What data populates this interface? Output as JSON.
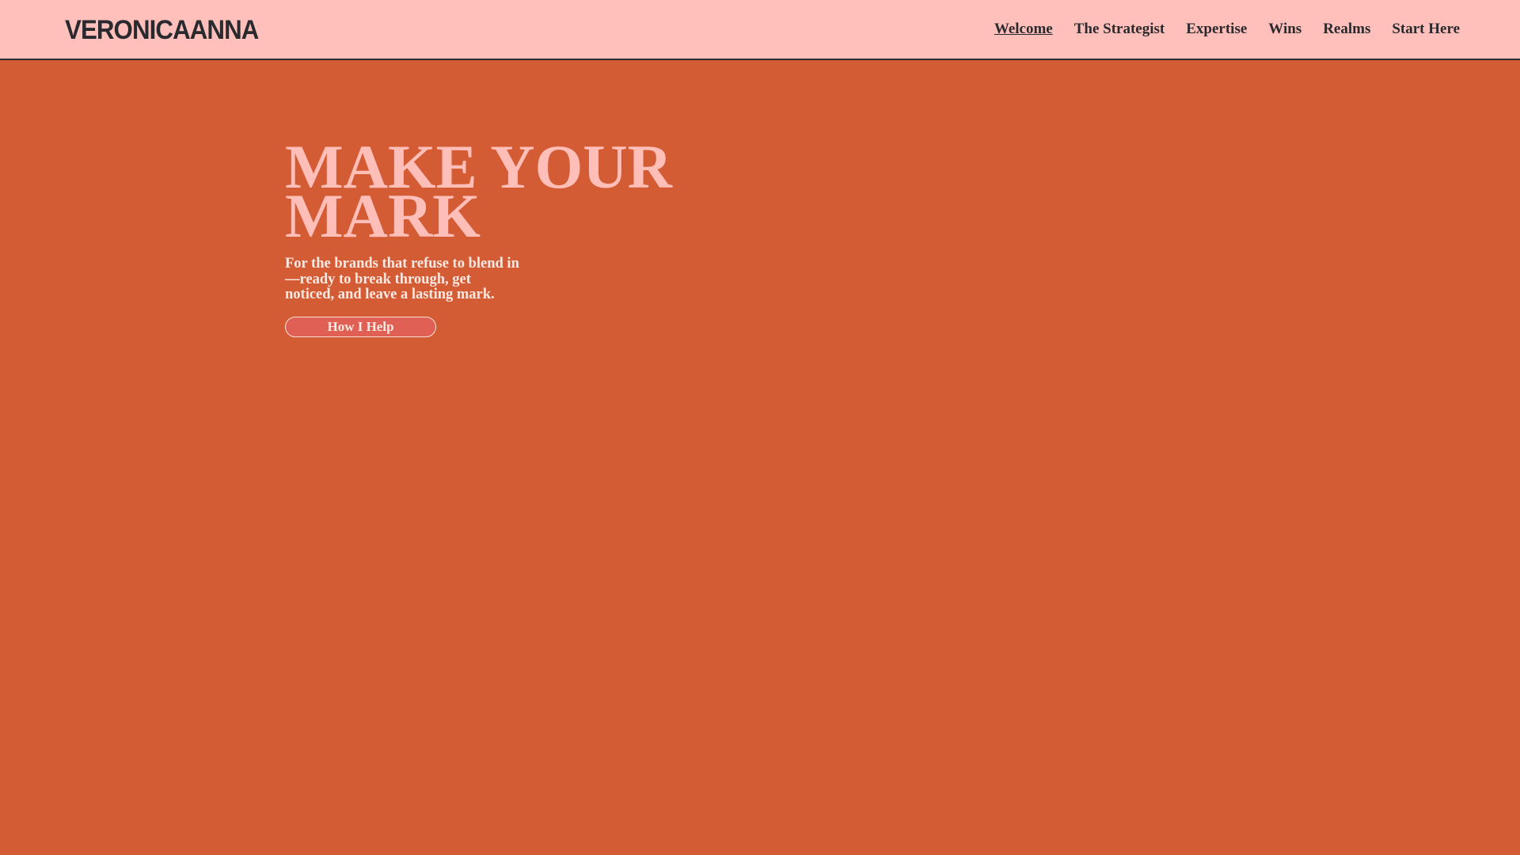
{
  "header": {
    "logo": "VERONICAANNA",
    "nav": [
      "Welcome",
      "The Strategist",
      "Expertise",
      "Wins",
      "Realms",
      "Start Here"
    ],
    "active": "Welcome"
  },
  "hero": {
    "title_line1": "MAKE YOUR",
    "title_line2": "MARK",
    "subtitle": "For the brands that refuse to blend in —ready to break through, get noticed, and leave a lasting mark.",
    "button": "How I Help"
  },
  "colors": {
    "header_bg": "#ffc0bb",
    "page_bg": "#d45c35",
    "title": "#ffbfb8",
    "button": "#e06055"
  }
}
